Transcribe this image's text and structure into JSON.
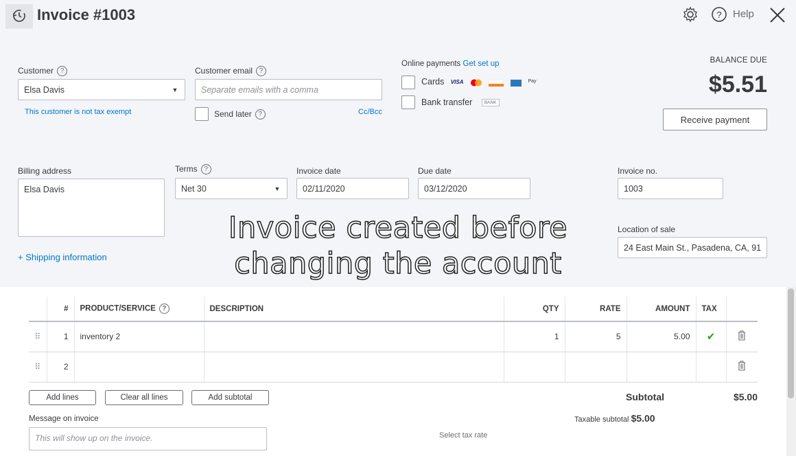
{
  "header": {
    "title": "Invoice #1003",
    "help_label": "Help"
  },
  "customer": {
    "label": "Customer",
    "value": "Elsa Davis",
    "tax_note": "This customer is not tax exempt"
  },
  "email": {
    "label": "Customer email",
    "placeholder": "Separate emails with a comma",
    "send_later_label": "Send later",
    "cc_bcc": "Cc/Bcc"
  },
  "online_payments": {
    "label": "Online payments",
    "setup_link": "Get set up",
    "cards_label": "Cards",
    "bank_label": "Bank transfer",
    "bank_badge": "BANK",
    "card_logos": [
      "VISA",
      "mastercard",
      "discover",
      "amex",
      "Pay"
    ]
  },
  "balance": {
    "label": "BALANCE DUE",
    "amount": "$5.51",
    "receive_button": "Receive payment"
  },
  "billing": {
    "label": "Billing address",
    "value": "Elsa Davis",
    "shipping_link": "+ Shipping information"
  },
  "terms": {
    "label": "Terms",
    "value": "Net 30"
  },
  "invoice_date": {
    "label": "Invoice date",
    "value": "02/11/2020"
  },
  "due_date": {
    "label": "Due date",
    "value": "03/12/2020"
  },
  "invoice_no": {
    "label": "Invoice no.",
    "value": "1003"
  },
  "location": {
    "label": "Location of sale",
    "value": "24 East Main St., Pasadena, CA, 91"
  },
  "overlay": {
    "line1": "Invoice created before",
    "line2": "changing the account"
  },
  "table": {
    "headers": {
      "num": "#",
      "product": "PRODUCT/SERVICE",
      "description": "DESCRIPTION",
      "qty": "QTY",
      "rate": "RATE",
      "amount": "AMOUNT",
      "tax": "TAX"
    },
    "rows": [
      {
        "num": "1",
        "product": "inventory 2",
        "description": "",
        "qty": "1",
        "rate": "5",
        "amount": "5.00",
        "tax": "✔"
      },
      {
        "num": "2",
        "product": "",
        "description": "",
        "qty": "",
        "rate": "",
        "amount": "",
        "tax": ""
      }
    ]
  },
  "line_buttons": {
    "add_lines": "Add lines",
    "clear_all": "Clear all lines",
    "add_subtotal": "Add subtotal"
  },
  "totals": {
    "subtotal_label": "Subtotal",
    "subtotal_value": "$5.00",
    "taxable_label": "Taxable subtotal",
    "taxable_value": "$5.00",
    "select_tax_rate": "Select tax rate"
  },
  "message": {
    "label": "Message on invoice",
    "placeholder": "This will show up on the invoice."
  },
  "colors": {
    "link": "#0077c5",
    "check": "#2ca01c",
    "background": "#f4f5f8"
  }
}
